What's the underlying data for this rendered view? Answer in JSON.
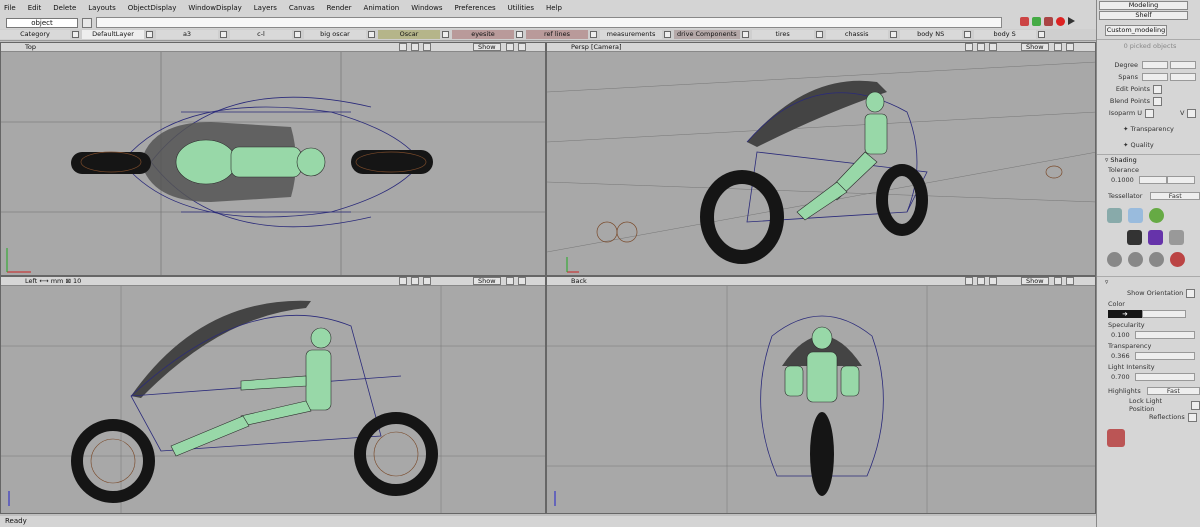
{
  "menu": [
    "File",
    "Edit",
    "Delete",
    "Layouts",
    "ObjectDisplay",
    "WindowDisplay",
    "Layers",
    "Canvas",
    "Render",
    "Animation",
    "Windows",
    "Preferences",
    "Utilities",
    "Help"
  ],
  "pick_field": "object",
  "layers": [
    {
      "label": "Category",
      "color": "#d9d9d9"
    },
    {
      "label": "DefaultLayer",
      "color": "#eeeeee"
    },
    {
      "label": "a3",
      "color": "#d9d9d9"
    },
    {
      "label": "c-l",
      "color": "#d9d9d9"
    },
    {
      "label": "big oscar",
      "color": "#d9d9d9"
    },
    {
      "label": "Oscar",
      "color": "#b5b58a"
    },
    {
      "label": "eyesite",
      "color": "#b99a9a"
    },
    {
      "label": "ref lines",
      "color": "#b99a9a"
    },
    {
      "label": "measurements",
      "color": "#d9d9d9"
    },
    {
      "label": "drive Components",
      "color": "#b5a8a8"
    },
    {
      "label": "tires",
      "color": "#d9d9d9"
    },
    {
      "label": "chassis",
      "color": "#d9d9d9"
    },
    {
      "label": "body NS",
      "color": "#d9d9d9"
    },
    {
      "label": "body S",
      "color": "#d9d9d9"
    }
  ],
  "panes": {
    "top": {
      "title": "Top",
      "show": "Show"
    },
    "persp": {
      "title": "Persp [Camera]",
      "show": "Show"
    },
    "left": {
      "title": "Left",
      "measure": "mm",
      "value": "10",
      "show": "Show"
    },
    "back": {
      "title": "Back",
      "show": "Show"
    }
  },
  "right_panel": {
    "mode": "Modeling",
    "shelf": "Shelf",
    "tab": "Custom_modeling",
    "picked": "0 picked objects",
    "degree": "Degree",
    "spans": "Spans",
    "edit_points": "Edit Points",
    "blend_points": "Blend Points",
    "isoparm_u": "Isoparm U",
    "isoparm_v": "V",
    "transparency_hdr": "Transparency",
    "quality_hdr": "Quality",
    "shading_hdr": "Shading",
    "tolerance_label": "Tolerance",
    "tolerance_value": "0.1000",
    "tessellator_label": "Tessellator",
    "tessellator_value": "Fast",
    "show_orientation": "Show Orientation",
    "color_label": "Color",
    "specularity_label": "Specularity",
    "specularity_value": "0.100",
    "transparency_label": "Transparency",
    "transparency_value": "0.366",
    "light_label": "Light Intensity",
    "light_value": "0.700",
    "highlights_label": "Highlights",
    "highlights_value": "Fast",
    "lock_light": "Lock Light Position",
    "reflections": "Reflections"
  },
  "status": "Ready",
  "colors": {
    "viewport": "#a8a8a8",
    "ui": "#d6d6d6",
    "wire_blue": "#2a2a7a",
    "wire_brown": "#7a4a2a",
    "body_green": "#98d8a8"
  }
}
